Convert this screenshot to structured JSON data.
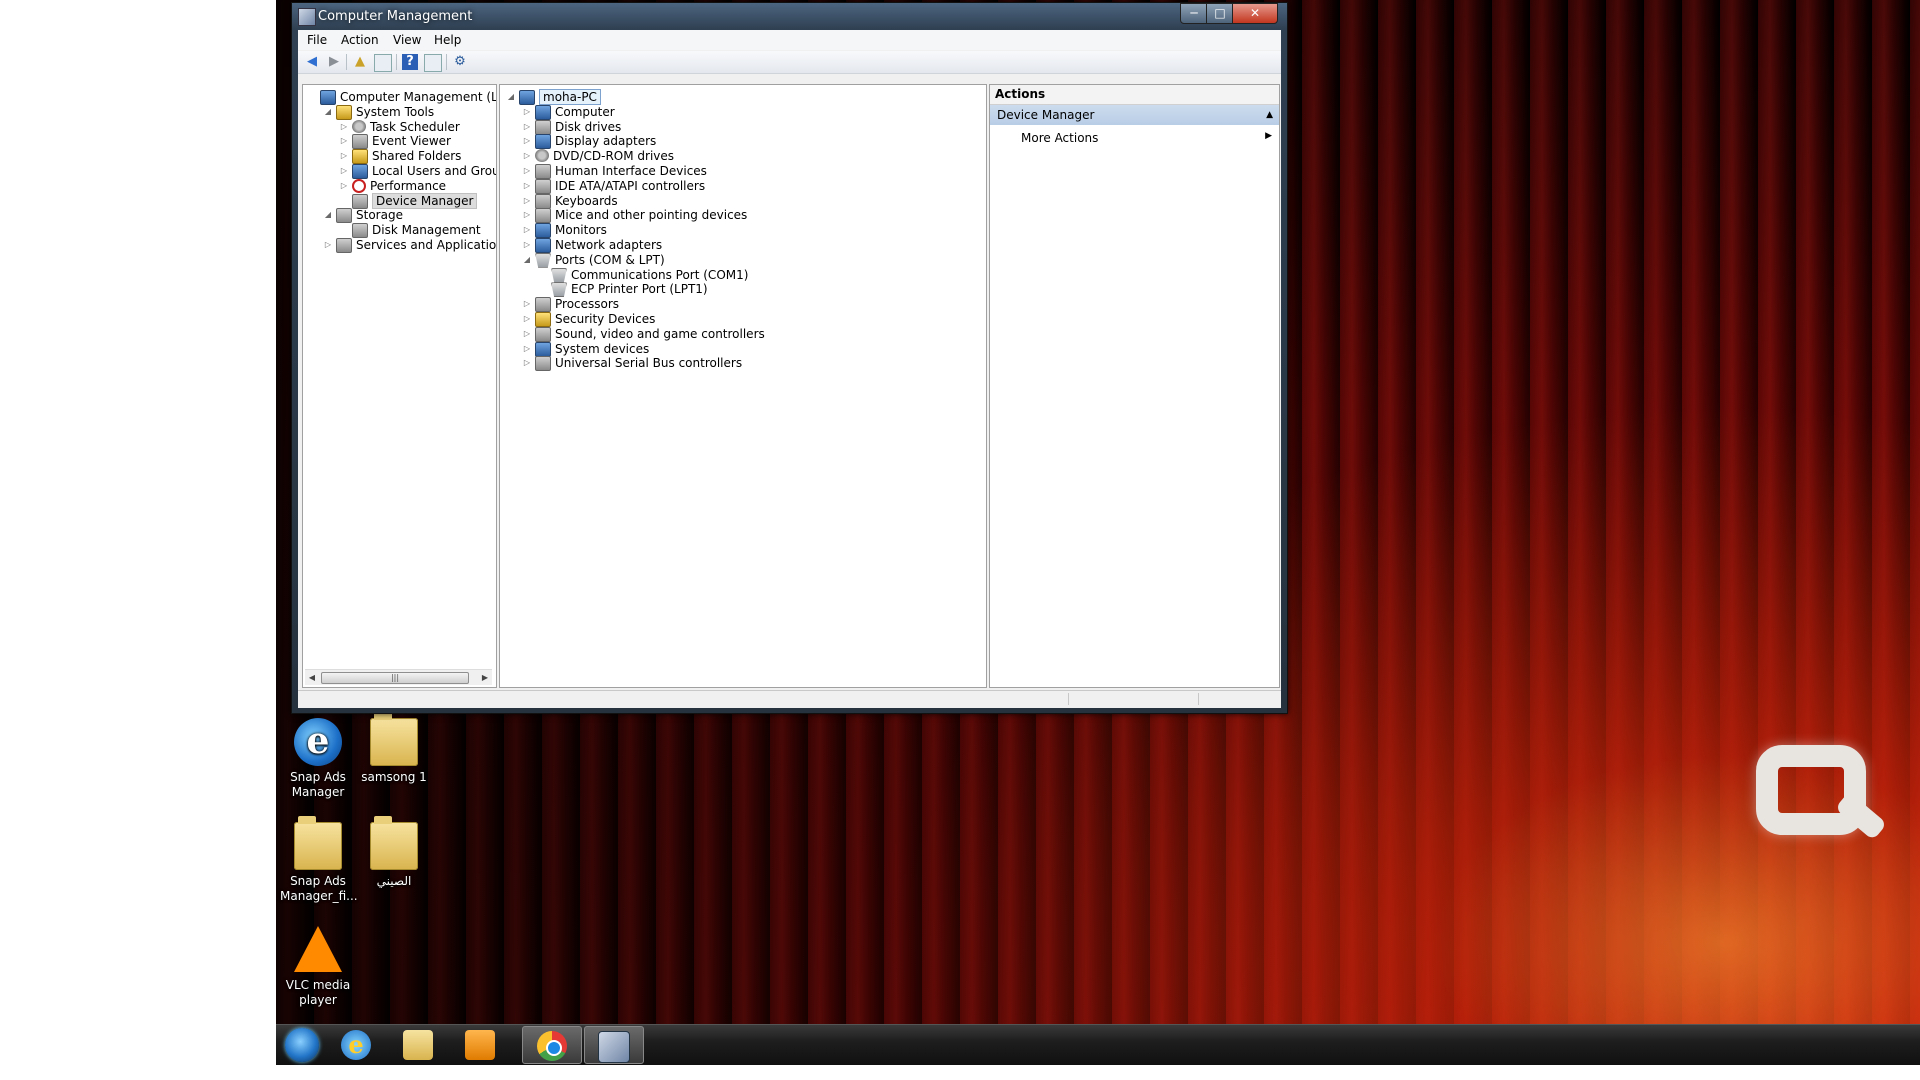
{
  "window": {
    "title": "Computer Management",
    "menu": [
      "File",
      "Action",
      "View",
      "Help"
    ]
  },
  "toolbar": {
    "icons": [
      "back-arrow",
      "forward-arrow",
      "up-folder",
      "show-hide-console-tree",
      "help",
      "properties",
      "scan-hardware"
    ]
  },
  "left_tree": [
    {
      "label": "Computer Management (Local",
      "level": 0,
      "expander": "",
      "icon": "computer"
    },
    {
      "label": "System Tools",
      "level": 1,
      "expander": "◢",
      "icon": "tools"
    },
    {
      "label": "Task Scheduler",
      "level": 2,
      "expander": "▷",
      "icon": "clock"
    },
    {
      "label": "Event Viewer",
      "level": 2,
      "expander": "▷",
      "icon": "event"
    },
    {
      "label": "Shared Folders",
      "level": 2,
      "expander": "▷",
      "icon": "folder"
    },
    {
      "label": "Local Users and Groups",
      "level": 2,
      "expander": "▷",
      "icon": "users"
    },
    {
      "label": "Performance",
      "level": 2,
      "expander": "▷",
      "icon": "performance"
    },
    {
      "label": "Device Manager",
      "level": 2,
      "expander": "",
      "icon": "device-manager",
      "selected": true
    },
    {
      "label": "Storage",
      "level": 1,
      "expander": "◢",
      "icon": "storage"
    },
    {
      "label": "Disk Management",
      "level": 2,
      "expander": "",
      "icon": "disk"
    },
    {
      "label": "Services and Applications",
      "level": 1,
      "expander": "▷",
      "icon": "services"
    }
  ],
  "device_tree": [
    {
      "label": "moha-PC",
      "level": 0,
      "expander": "◢",
      "icon": "computer",
      "root": true
    },
    {
      "label": "Computer",
      "level": 1,
      "expander": "▷",
      "icon": "computer"
    },
    {
      "label": "Disk drives",
      "level": 1,
      "expander": "▷",
      "icon": "disk"
    },
    {
      "label": "Display adapters",
      "level": 1,
      "expander": "▷",
      "icon": "monitor"
    },
    {
      "label": "DVD/CD-ROM drives",
      "level": 1,
      "expander": "▷",
      "icon": "dvd"
    },
    {
      "label": "Human Interface Devices",
      "level": 1,
      "expander": "▷",
      "icon": "hid"
    },
    {
      "label": "IDE ATA/ATAPI controllers",
      "level": 1,
      "expander": "▷",
      "icon": "ide"
    },
    {
      "label": "Keyboards",
      "level": 1,
      "expander": "▷",
      "icon": "keyboard"
    },
    {
      "label": "Mice and other pointing devices",
      "level": 1,
      "expander": "▷",
      "icon": "mouse"
    },
    {
      "label": "Monitors",
      "level": 1,
      "expander": "▷",
      "icon": "monitor"
    },
    {
      "label": "Network adapters",
      "level": 1,
      "expander": "▷",
      "icon": "network"
    },
    {
      "label": "Ports (COM & LPT)",
      "level": 1,
      "expander": "◢",
      "icon": "port"
    },
    {
      "label": "Communications Port (COM1)",
      "level": 2,
      "expander": "",
      "icon": "port"
    },
    {
      "label": "ECP Printer Port (LPT1)",
      "level": 2,
      "expander": "",
      "icon": "port"
    },
    {
      "label": "Processors",
      "level": 1,
      "expander": "▷",
      "icon": "processor"
    },
    {
      "label": "Security Devices",
      "level": 1,
      "expander": "▷",
      "icon": "security"
    },
    {
      "label": "Sound, video and game controllers",
      "level": 1,
      "expander": "▷",
      "icon": "sound"
    },
    {
      "label": "System devices",
      "level": 1,
      "expander": "▷",
      "icon": "system"
    },
    {
      "label": "Universal Serial Bus controllers",
      "level": 1,
      "expander": "▷",
      "icon": "usb"
    }
  ],
  "actions": {
    "header": "Actions",
    "section": "Device Manager",
    "more": "More Actions"
  },
  "desktop_icons": [
    {
      "label": "Snap Ads Manager",
      "icon": "ie"
    },
    {
      "label": "samsong 1",
      "icon": "folder"
    },
    {
      "label": "Snap Ads Manager_fi...",
      "icon": "folder-doc"
    },
    {
      "label": "الصيني",
      "icon": "folder"
    },
    {
      "label": "VLC media player",
      "icon": "vlc"
    }
  ],
  "taskbar": {
    "items": [
      "start-orb",
      "internet-explorer",
      "windows-explorer",
      "media-player",
      "chrome",
      "computer-management"
    ]
  },
  "colors": {
    "selection": "#e5f1fb",
    "actions_section": "#c7d8ec",
    "taskbar": "#1e1e1e"
  }
}
